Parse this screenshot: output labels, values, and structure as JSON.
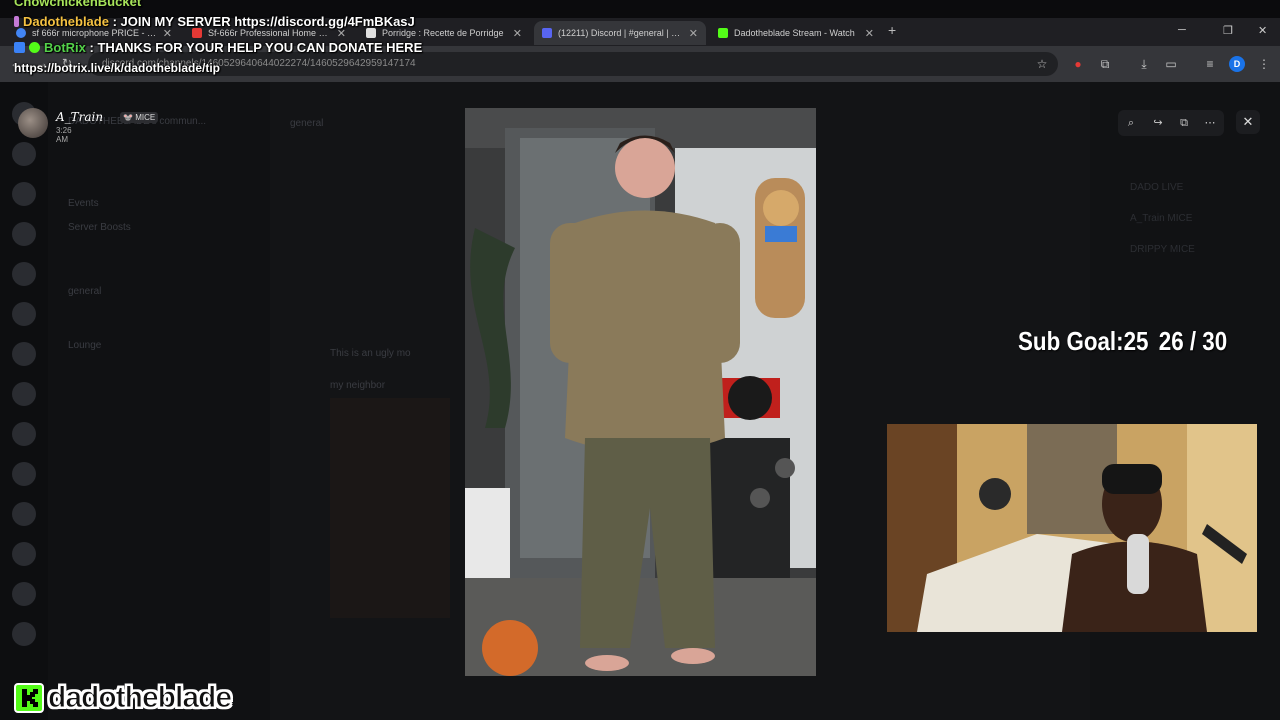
{
  "chat": {
    "line0": {
      "user": "ChowchickenBucket",
      "text": ""
    },
    "line1": {
      "user": "Dadotheblade",
      "text": " : JOIN MY SERVER https://discord.gg/4FmBKasJ"
    },
    "line2": {
      "user": "BotRix",
      "text": " : THANKS FOR YOUR HELP YOU CAN DONATE HERE"
    },
    "line3": {
      "text": "https://botrix.live/k/dadotheblade/tip"
    }
  },
  "browser": {
    "tabs": [
      {
        "label": "sf 666r microphone PRICE - Rec",
        "favicon_color": "#4285f4"
      },
      {
        "label": "Sf-666r Professional Home Stu",
        "favicon_color": "#e53935"
      },
      {
        "label": "Porridge : Recette de Porridge",
        "favicon_color": "#e0e0e0"
      },
      {
        "label": "(12211) Discord | #general | DA",
        "favicon_color": "#5865f2"
      },
      {
        "label": "Dadotheblade Stream - Watch",
        "favicon_color": "#53fc18"
      }
    ],
    "url": "discord.com/channels/1460529640644022274/1460529642959147174",
    "profile_initial": "D"
  },
  "discord_bg": {
    "server_name": "DADOTHEBLADE's commun...",
    "channel_header": "general",
    "channels": [
      "Events",
      "Server Boosts",
      "general",
      "Lounge"
    ],
    "messages": [
      "This is an ugly mo",
      "my neighbor"
    ],
    "members": [
      "DADO LIVE",
      "A_Train MICE",
      "DRIPPY MICE"
    ]
  },
  "lightbox": {
    "user_name": "A_Train",
    "tag": "MICE",
    "time": "3:26 AM"
  },
  "overlay": {
    "sub_goal_label": "Sub Goal:25",
    "sub_goal_progress": "26 / 30",
    "streamer_name": "dadotheblade"
  }
}
